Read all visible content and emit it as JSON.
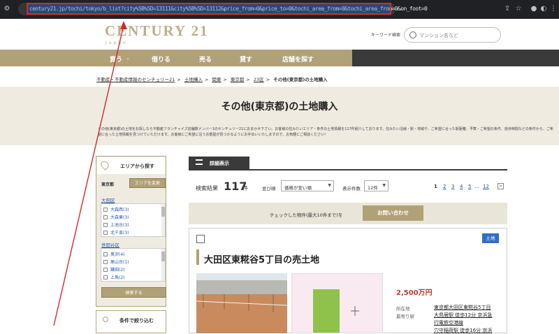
{
  "browser": {
    "url": "century21.jp/tochi/tokyo/b_list?city%5B%5D=13111&city%5B%5D=13112&price_from=0&price_to=0&tochi_area_from=0&tochi_area_from=0&on_foot=0"
  },
  "header": {
    "logo_main": "CENTURY 21",
    "logo_sub": "Japan",
    "keyword_label": "キーワード検索",
    "search_placeholder": "マンション名など"
  },
  "nav": {
    "items": [
      "買う",
      "借りる",
      "売る",
      "貸す",
      "店舗を探す"
    ]
  },
  "breadcrumb": [
    "不動産・不動産情報のセンチュリー21",
    "土地購入",
    "関東",
    "東京都",
    "23区",
    "その他(東京都)の土地購入"
  ],
  "page": {
    "title": "その他(東京都)の土地購入",
    "intro": "その他(東京都)の土地をお探しなら不動産フランチャイズ店舗数ナンバー1のセンチュリー21におまかせ下さい。お客様の住みたいエリア・条件の土地情報を117件紹介しております。住みたい沿線・駅・地域や、ご希望に合った駅距離、予算・ご希望の条件、徒歩時間などの条件から、ご希望に合った土地情報を見つけていただけます。お客様にご希望に沿うお部屋が見つかるようにお手伝いいたしますので、お気軽にご相談ください!"
  },
  "sidebar": {
    "title": "エリアから探す",
    "prefecture": "東京都",
    "change_area": "エリアを変更",
    "wards": [
      {
        "name": "大田区",
        "items": [
          "大森西(3)",
          "大森東(3)",
          "上池台(3)",
          "北千束(3)"
        ]
      },
      {
        "name": "世田谷区",
        "items": [
          "奥沢(4)",
          "尾山台(1)",
          "鎌田(2)",
          "上馬(2)"
        ]
      }
    ],
    "search_button": "検索する",
    "filter_title": "条件で絞り込む"
  },
  "main": {
    "tab_label": "詳細表示",
    "results_label": "検索結果",
    "results_count": "117",
    "results_unit": "件",
    "sort_label": "並び順",
    "sort_value": "価格が安い順",
    "perpage_label": "表示件数",
    "perpage_value": "12件",
    "pages": [
      "1",
      "2",
      "3",
      "4",
      "5",
      "...",
      "12"
    ],
    "pager_next": ">",
    "inquiry_text": "チェックした物件(最大10件まで)を",
    "inquiry_button": "お問い合わせ"
  },
  "property": {
    "badge": "土地",
    "title": "大田区東糀谷5丁目の売土地",
    "price": "2,500万円",
    "location_key": "所在地",
    "location_value": "東京都大田区東糀谷5丁目",
    "station_key": "最寄り駅",
    "station_line1": "大鳥居駅 徒歩12分 京浜急",
    "station_line2": "行電鉄空港線",
    "station_line3": "穴守稲荷駅 徒歩16分 京浜"
  },
  "colors": {
    "gold": "#b1a176",
    "beige": "#efebe1",
    "annotation_red": "#d32a2a"
  }
}
